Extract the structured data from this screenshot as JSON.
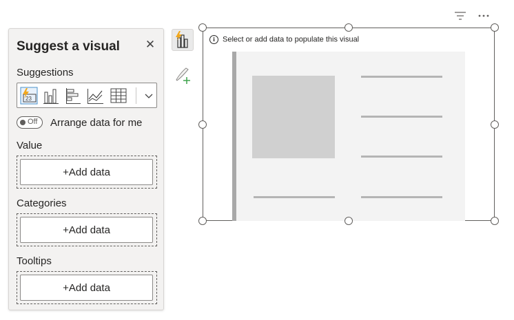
{
  "suggest_pane": {
    "title": "Suggest a visual",
    "close_glyph": "✕",
    "suggestions_label": "Suggestions",
    "suggestion_icons": [
      "lightning-card-icon",
      "clustered-column-chart-icon",
      "clustered-bar-chart-icon",
      "line-chart-icon",
      "table-icon"
    ],
    "toggle_state": "Off",
    "toggle_label": "Arrange data for me",
    "value_label": "Value",
    "categories_label": "Categories",
    "tooltips_label": "Tooltips",
    "add_data_label": "+Add data"
  },
  "visual": {
    "info_text": "Select or add data to populate this visual",
    "info_glyph": "i"
  },
  "colors": {
    "accent_orange": "#f2a81d",
    "accent_green": "#3fa34d",
    "pane_bg": "#f3f2f1",
    "placeholder_bg": "#f3f3f3"
  }
}
